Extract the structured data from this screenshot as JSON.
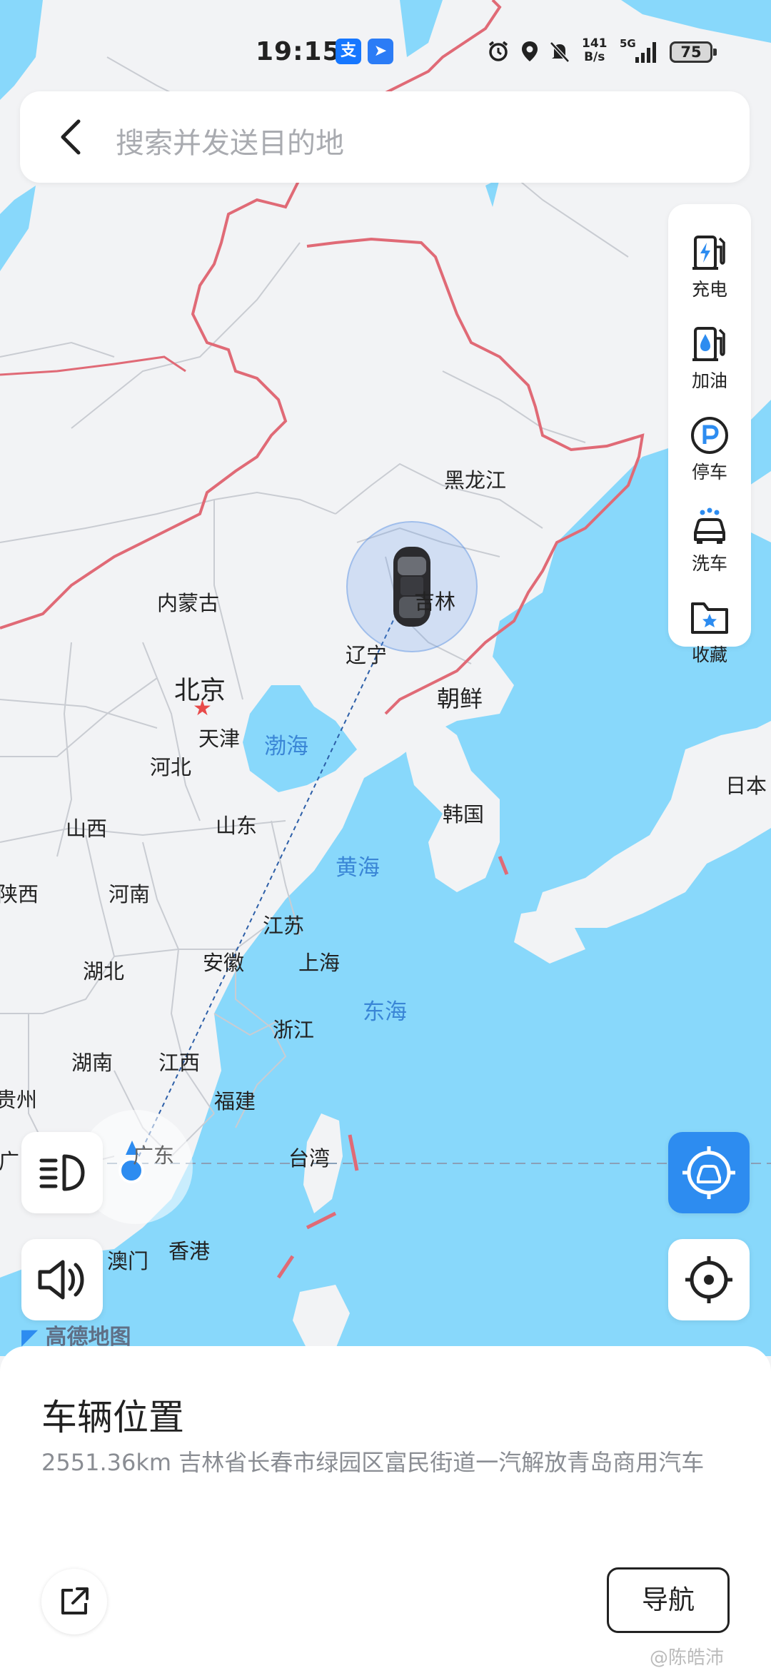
{
  "status_bar": {
    "time": "19:15",
    "app_icons": [
      {
        "name": "alipay-icon",
        "glyph": "支",
        "color": "#1677ff"
      },
      {
        "name": "app-arrow-icon",
        "glyph": "➤",
        "color": "#2b7cf6"
      }
    ],
    "net_speed_top": "141",
    "net_speed_bottom": "B/s",
    "signal": "5G",
    "battery": "75"
  },
  "search": {
    "placeholder": "搜索并发送目的地"
  },
  "right_panel": {
    "items": [
      {
        "label": "充电",
        "icon": "charging-station-icon"
      },
      {
        "label": "加油",
        "icon": "fuel-station-icon"
      },
      {
        "label": "停车",
        "icon": "parking-icon"
      },
      {
        "label": "洗车",
        "icon": "car-wash-icon"
      },
      {
        "label": "收藏",
        "icon": "favorite-folder-icon"
      }
    ]
  },
  "map": {
    "labels": {
      "heilongjiang": "黑龙江",
      "jilin": "吉林",
      "neimenggu": "内蒙古",
      "liaoning": "辽宁",
      "beijing": "北京",
      "tianjin": "天津",
      "chaoxian": "朝鲜",
      "bohai": "渤海",
      "hebei": "河北",
      "riben": "日本",
      "hanguo": "韩国",
      "shanxi": "山西",
      "shandong": "山东",
      "huanghai": "黄海",
      "shaanxi": "陕西",
      "henan": "河南",
      "jiangsu": "江苏",
      "anhui": "安徽",
      "shanghai": "上海",
      "hubei": "湖北",
      "zhejiang": "浙江",
      "donghai": "东海",
      "hunan": "湖南",
      "jiangxi": "江西",
      "guizhou": "贵州",
      "fujian": "福建",
      "guangdong": "广东",
      "taiwan": "台湾",
      "guangxi": "广",
      "aomen": "澳门",
      "xianggang": "香港"
    },
    "logo_text": "高德地图",
    "colors": {
      "sea": "#88d8fb",
      "land": "#f2f3f5",
      "border": "#e06a76",
      "accent": "#2d8cf0"
    }
  },
  "bottom_sheet": {
    "title": "车辆位置",
    "address": "2551.36km 吉林省长春市绿园区富民街道一汽解放青岛商用汽车",
    "navigate_label": "导航"
  },
  "watermark": "@陈皓沛"
}
